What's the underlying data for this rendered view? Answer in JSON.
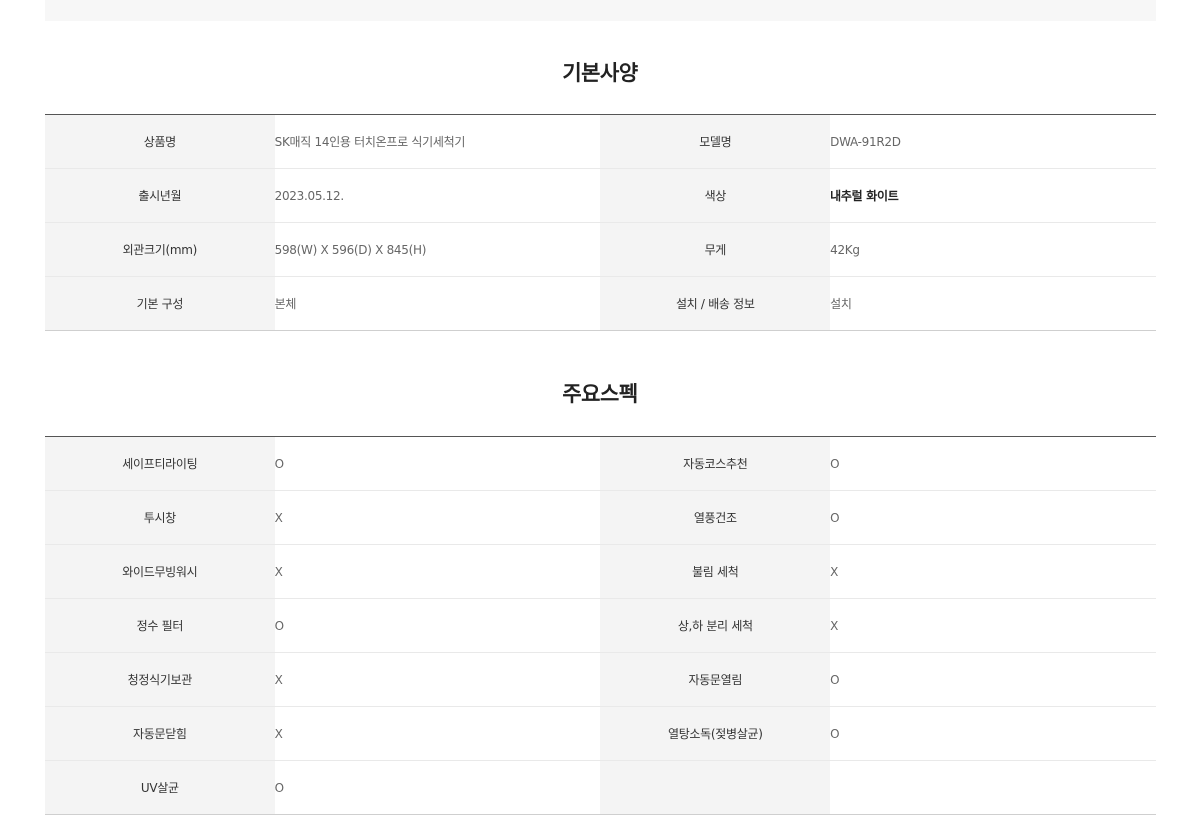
{
  "basic": {
    "title": "기본사양",
    "rows": [
      {
        "l1": "상품명",
        "v1": "SK매직 14인용 터치온프로 식기세척기",
        "l2": "모델명",
        "v2": "DWA-91R2D"
      },
      {
        "l1": "출시년월",
        "v1": "2023.05.12.",
        "l2": "색상",
        "v2": "내추럴 화이트"
      },
      {
        "l1": "외관크기(mm)",
        "v1": "598(W) X 596(D) X 845(H)",
        "l2": "무게",
        "v2": "42Kg"
      },
      {
        "l1": "기본 구성",
        "v1": "본체",
        "l2": "설치 / 배송 정보",
        "v2": "설치"
      }
    ]
  },
  "spec": {
    "title": "주요스펙",
    "rows": [
      {
        "l1": "세이프티라이팅",
        "v1": "O",
        "l2": "자동코스추천",
        "v2": "O"
      },
      {
        "l1": "투시창",
        "v1": "X",
        "l2": "열풍건조",
        "v2": "O"
      },
      {
        "l1": "와이드무빙워시",
        "v1": "X",
        "l2": "불림 세척",
        "v2": "X"
      },
      {
        "l1": "정수 필터",
        "v1": "O",
        "l2": "상,하 분리 세척",
        "v2": "X"
      },
      {
        "l1": "청정식기보관",
        "v1": "X",
        "l2": "자동문열림",
        "v2": "O"
      },
      {
        "l1": "자동문닫힘",
        "v1": "X",
        "l2": "열탕소독(젖병살균)",
        "v2": "O"
      },
      {
        "l1": "UV살균",
        "v1": "O",
        "l2": "",
        "v2": ""
      }
    ]
  }
}
